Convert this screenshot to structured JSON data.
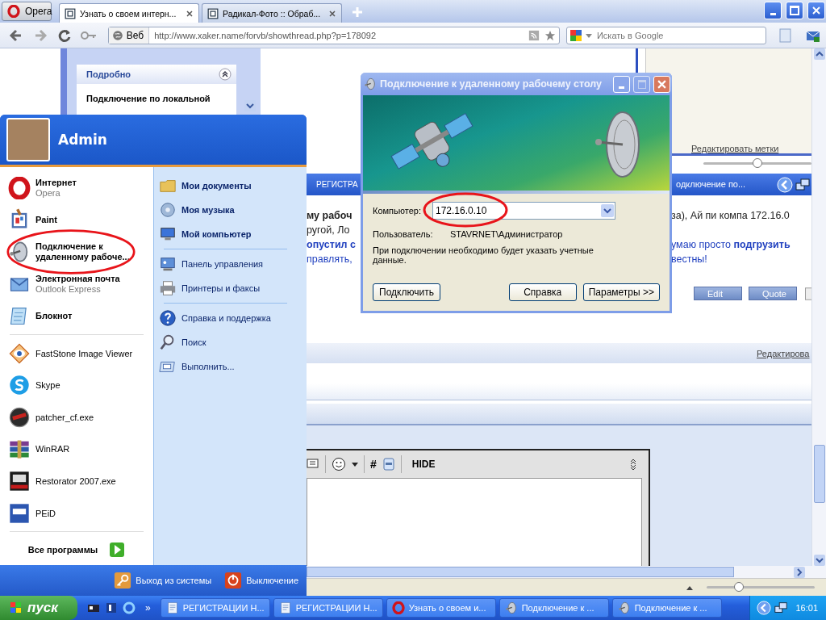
{
  "browser": {
    "menu_button": "Opera",
    "tabs": [
      {
        "label": "Узнать о своем интерн...",
        "selected": true
      },
      {
        "label": "Радикал-Фото :: Обраб...",
        "selected": false
      }
    ],
    "address": {
      "scope": "Веб",
      "url": "http://www.xaker.name/forvb/showthread.php?p=178092"
    },
    "search": {
      "placeholder": "Искать в Google"
    }
  },
  "page": {
    "side_panel": {
      "title": "Подробно",
      "item": "Подключение по локальной"
    },
    "tags_link": "Редактировать метки",
    "inner_zoom": {
      "level": 0.5
    },
    "inner_taskbar": [
      "РЕГИСТРА",
      "одключение по..."
    ],
    "post_rows": [
      {
        "left": {
          "text": "му рабоч",
          "bold": true,
          "link": false
        },
        "right": {
          "text": "за), Ай пи компа 172.16.0",
          "bold": false,
          "link": false
        }
      },
      {
        "left": {
          "text": "ругой, Ло",
          "bold": false,
          "link": false
        }
      },
      {
        "left": {
          "text": "опустил с",
          "bold": true,
          "link": true
        },
        "right": {
          "text": "умаю просто **подгрузить**",
          "bold": false,
          "link": true
        }
      },
      {
        "left": {
          "text": "правлять,",
          "bold": false,
          "link": true
        },
        "right": {
          "text": "вестны!",
          "bold": false,
          "link": true
        }
      }
    ],
    "post_buttons": [
      "Edit",
      "Quote"
    ],
    "edit_link": "Редактирова",
    "editor": {
      "hash": "#",
      "hide": "HIDE"
    }
  },
  "status_bar": {
    "zoom": {
      "level": 0.3
    }
  },
  "start_menu": {
    "user": "Admin",
    "pinned": [
      {
        "name": "Интернет",
        "sub": "Opera",
        "kind": "opera"
      },
      {
        "name": "Paint",
        "kind": "paint"
      },
      {
        "name": "Подключение к удаленному рабоче...",
        "kind": "remote"
      },
      {
        "name": "Электронная почта",
        "sub": "Outlook Express",
        "kind": "mail"
      },
      {
        "name": "Блокнот",
        "kind": "notepad"
      }
    ],
    "recent": [
      {
        "name": "FastStone Image Viewer",
        "kind": "eye"
      },
      {
        "name": "Skype",
        "kind": "skype"
      },
      {
        "name": "patcher_cf.exe",
        "kind": "emblem"
      },
      {
        "name": "WinRAR",
        "kind": "books"
      },
      {
        "name": "Restorator 2007.exe",
        "kind": "res"
      },
      {
        "name": "PEiD",
        "kind": "peid"
      }
    ],
    "all_programs": "Все программы",
    "places": [
      [
        {
          "label": "Мои документы",
          "bold": true,
          "kind": "folder"
        },
        {
          "label": "Моя музыка",
          "bold": true,
          "kind": "music"
        },
        {
          "label": "Мой компьютер",
          "bold": true,
          "kind": "computer"
        }
      ],
      [
        {
          "label": "Панель управления",
          "bold": false,
          "kind": "control"
        },
        {
          "label": "Принтеры и факсы",
          "bold": false,
          "kind": "printer"
        }
      ],
      [
        {
          "label": "Справка и поддержка",
          "bold": false,
          "kind": "help"
        },
        {
          "label": "Поиск",
          "bold": false,
          "kind": "search"
        },
        {
          "label": "Выполнить...",
          "bold": false,
          "kind": "run"
        }
      ]
    ],
    "log_off": "Выход из системы",
    "shut_down": "Выключение"
  },
  "dialog": {
    "title": "Подключение к удаленному рабочему столу",
    "computer_label": "Компьютер:",
    "computer_value": "172.16.0.10",
    "user_label": "Пользователь:",
    "user_value": "STAVRNET\\Администратор",
    "note": "При подключении необходимо будет указать учетные данные.",
    "buttons": [
      "Подключить",
      "Справка",
      "Параметры >>"
    ]
  },
  "taskbar": {
    "start": "пуск",
    "more": "»",
    "tasks": [
      {
        "label": "РЕГИСТРАЦИИ Н...",
        "kind": "doc"
      },
      {
        "label": "РЕГИСТРАЦИИ Н...",
        "kind": "doc"
      },
      {
        "label": "Узнать о своем и...",
        "kind": "opera"
      },
      {
        "label": "Подключение к ...",
        "kind": "remote"
      },
      {
        "label": "Подключение к ...",
        "kind": "remote"
      }
    ],
    "clock": "16:01"
  }
}
